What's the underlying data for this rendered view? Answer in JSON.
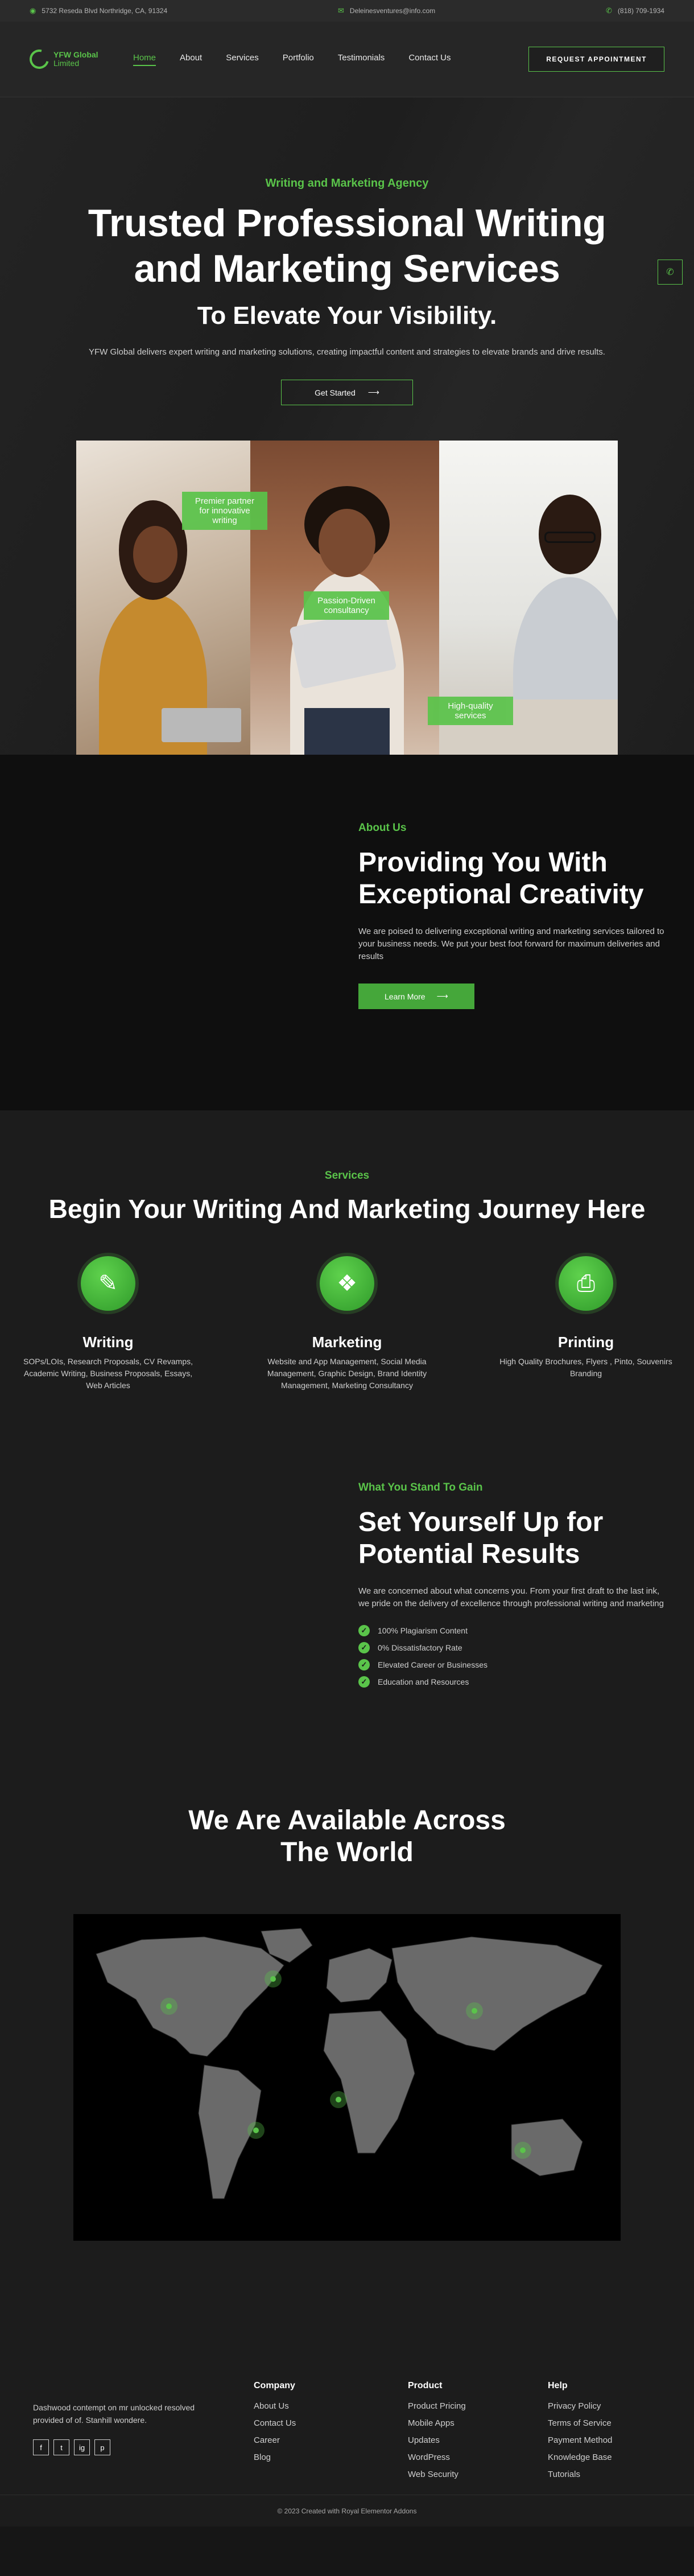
{
  "topbar": {
    "address": "5732 Reseda Blvd Northridge, CA, 91324",
    "email": "Deleinesventures@info.com",
    "phone": "(818) 709-1934"
  },
  "header": {
    "logo_line1": "YFW Global",
    "logo_line2": "Limited",
    "nav": [
      "Home",
      "About",
      "Services",
      "Portfolio",
      "Testimonials",
      "Contact Us"
    ],
    "cta": "REQUEST APPOINTMENT"
  },
  "hero": {
    "eyebrow": "Writing and Marketing Agency",
    "title_line1": "Trusted Professional Writing",
    "title_line2": "and Marketing Services",
    "subtitle": "To Elevate Your Visibility.",
    "description": "YFW Global delivers expert writing and marketing solutions, creating impactful content and strategies to elevate brands and drive results.",
    "button": "Get Started",
    "tags": [
      "Premier partner for innovative writing",
      "Passion-Driven consultancy",
      "High-quality services"
    ]
  },
  "about": {
    "eyebrow": "About Us",
    "title_line1": "Providing You With",
    "title_line2": "Exceptional Creativity",
    "description": "We are poised to delivering exceptional writing and marketing services tailored to your business needs. We put your best foot forward for maximum deliveries and results",
    "button": "Learn More"
  },
  "services": {
    "eyebrow": "Services",
    "title": "Begin Your Writing And Marketing Journey Here",
    "items": [
      {
        "name": "Writing",
        "desc": "SOPs/LOIs, Research Proposals, CV Revamps, Academic Writing, Business Proposals, Essays, Web Articles",
        "icon": "pen-paper-icon"
      },
      {
        "name": "Marketing",
        "desc": "Website and App Management, Social Media Management, Graphic Design, Brand Identity Management, Marketing Consultancy",
        "icon": "megaphone-icon"
      },
      {
        "name": "Printing",
        "desc": "High Quality Brochures, Flyers , Pinto, Souvenirs Branding",
        "icon": "printer-icon"
      }
    ]
  },
  "stand": {
    "eyebrow": "What You Stand To Gain",
    "title_line1": "Set Yourself Up for",
    "title_line2": "Potential Results",
    "description": "We are concerned about what concerns you. From your first draft to the last ink, we pride on the delivery of excellence through professional writing and marketing",
    "checks": [
      "100% Plagiarism Content",
      "0% Dissatisfactory Rate",
      "Elevated Career or Businesses",
      "Education and Resources"
    ]
  },
  "world": {
    "title_line1": "We Are Available Across",
    "title_line2": "The World"
  },
  "footer": {
    "desc": "Dashwood contempt on mr unlocked resolved provided of of. Stanhill wondere.",
    "socials": [
      "f",
      "t",
      "ig",
      "p"
    ],
    "columns": [
      {
        "title": "Company",
        "links": [
          "About Us",
          "Contact Us",
          "Career",
          "Blog"
        ]
      },
      {
        "title": "Product",
        "links": [
          "Product Pricing",
          "Mobile Apps",
          "Updates",
          "WordPress",
          "Web Security"
        ]
      },
      {
        "title": "Help",
        "links": [
          "Privacy Policy",
          "Terms of Service",
          "Payment Method",
          "Knowledge Base",
          "Tutorials"
        ]
      }
    ],
    "copyright": "© 2023 Created with Royal Elementor Addons"
  },
  "colors": {
    "accent": "#5ac44a",
    "bg": "#161616"
  }
}
